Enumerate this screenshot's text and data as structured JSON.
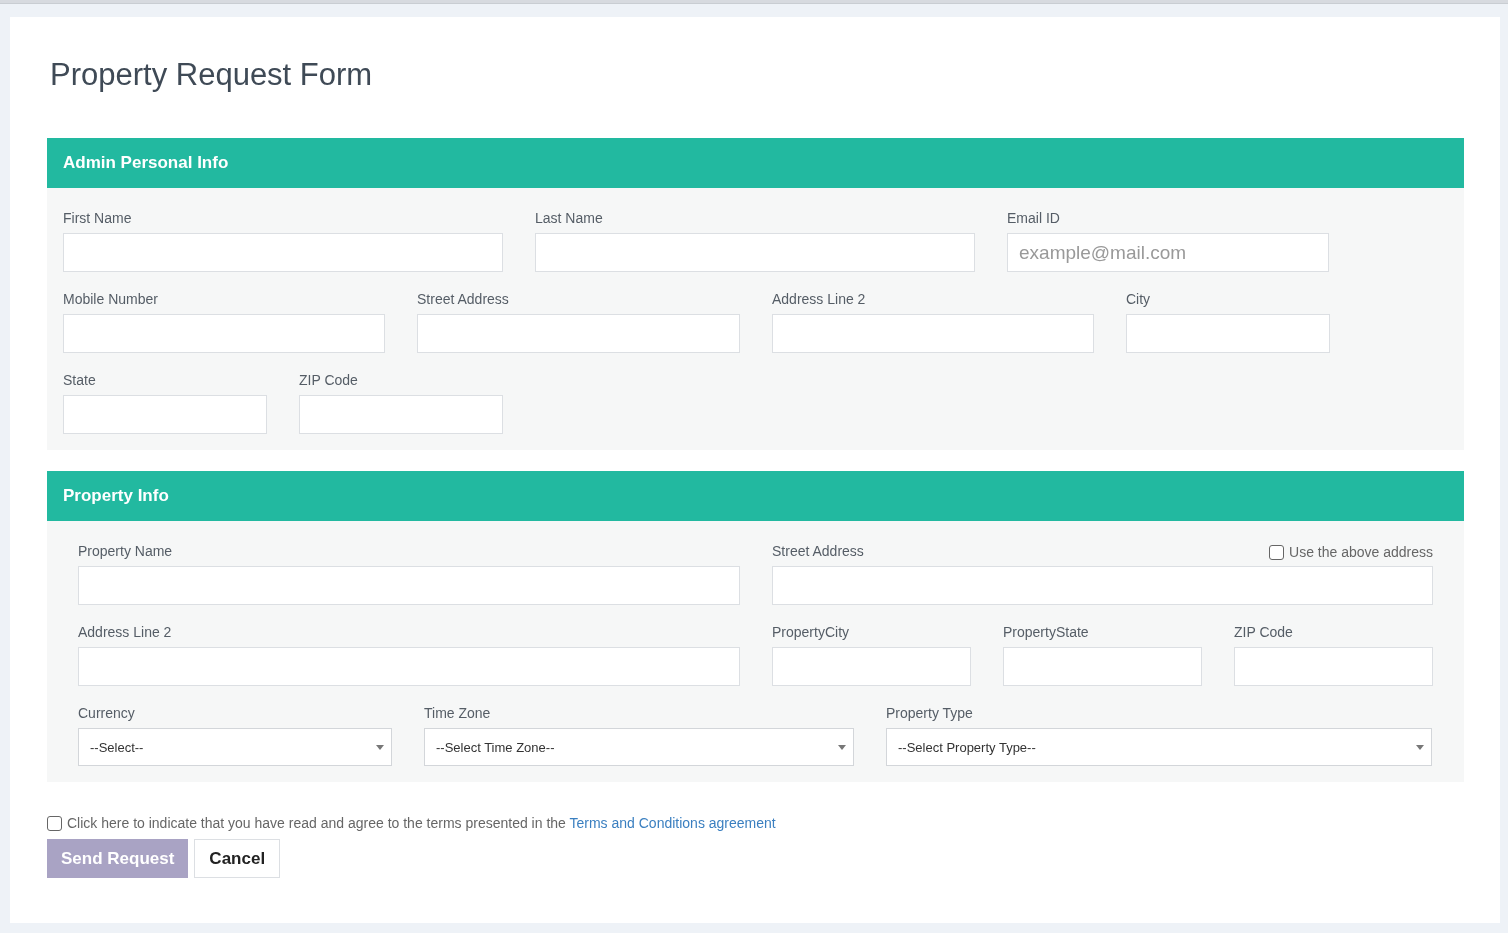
{
  "title": "Property Request Form",
  "sections": [
    {
      "heading": "Admin Personal Info",
      "field_groups": [
        {
          "fields": [
            {
              "kind": "text",
              "label": "First Name"
            },
            {
              "kind": "text",
              "label": "Last Name"
            },
            {
              "kind": "text",
              "label": "Email ID",
              "placeholder": "example@mail.com"
            }
          ]
        },
        {
          "fields": [
            {
              "kind": "text",
              "label": "Mobile Number"
            },
            {
              "kind": "text",
              "label": "Street Address"
            },
            {
              "kind": "text",
              "label": "Address Line 2"
            },
            {
              "kind": "text",
              "label": "City"
            }
          ]
        },
        {
          "fields": [
            {
              "kind": "text",
              "label": "State"
            },
            {
              "kind": "text",
              "label": "ZIP Code"
            }
          ]
        }
      ]
    },
    {
      "heading": "Property Info",
      "field_groups": [
        {
          "fields": [
            {
              "kind": "text",
              "label": "Property Name"
            },
            {
              "kind": "text",
              "label": "Street Address",
              "option": {
                "label": "Use the above address",
                "checked": false
              }
            }
          ]
        },
        {
          "fields": [
            {
              "kind": "text",
              "label": "Address Line 2"
            },
            {
              "kind": "text",
              "label": "PropertyCity"
            },
            {
              "kind": "text",
              "label": "PropertyState"
            },
            {
              "kind": "text",
              "label": "ZIP Code"
            }
          ]
        },
        {
          "fields": [
            {
              "kind": "select",
              "label": "Currency",
              "value": "--Select--"
            },
            {
              "kind": "select",
              "label": "Time Zone",
              "value": "--Select Time Zone--"
            },
            {
              "kind": "select",
              "label": "Property Type",
              "value": "--Select Property Type--"
            }
          ]
        }
      ]
    }
  ],
  "agreement": {
    "checked": false,
    "text": "Click here to indicate that you have read and agree to the terms presented in the",
    "link": "Terms and Conditions agreement"
  },
  "buttons": [
    {
      "label": "Send Request",
      "kind": "primary",
      "disabled": true
    },
    {
      "label": "Cancel",
      "kind": "secondary",
      "disabled": false
    }
  ]
}
